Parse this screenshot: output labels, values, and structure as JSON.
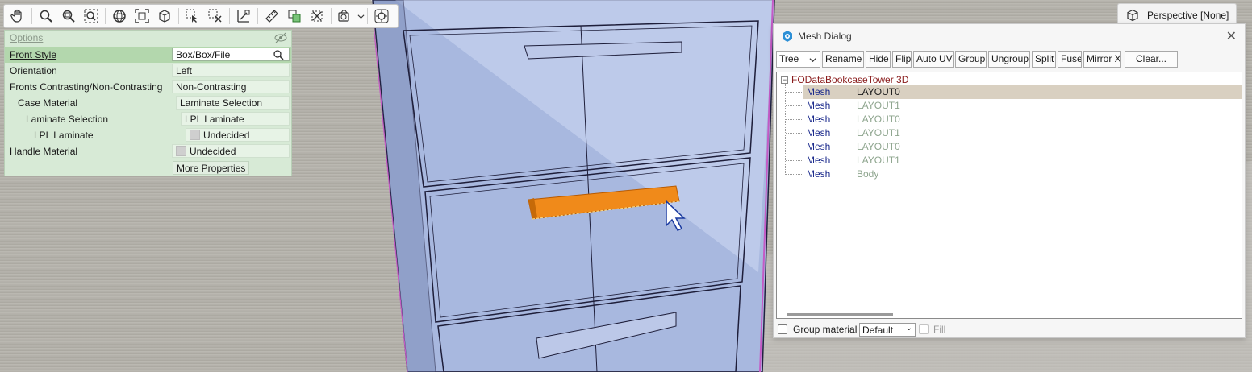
{
  "toolbar": {
    "icons": [
      "pan-hand-icon",
      "zoom-icon",
      "zoom-window-icon",
      "zoom-extents-icon",
      "orbit-icon",
      "frame-selection-icon",
      "view-cube-icon",
      "select-icon",
      "deselect-icon",
      "dimension-icon",
      "measure-icon",
      "add-object-icon",
      "delete-object-icon",
      "camera-icon",
      "target-icon"
    ]
  },
  "options": {
    "title": "Options",
    "rows": [
      {
        "label": "Front Style",
        "value": "Box/Box/File"
      },
      {
        "label": "Orientation",
        "value": "Left"
      },
      {
        "label": "Fronts Contrasting/Non-Contrasting",
        "value": "Non-Contrasting"
      },
      {
        "label": "Case Material",
        "value": "Laminate Selection"
      },
      {
        "label": "Laminate Selection",
        "value": "LPL Laminate"
      },
      {
        "label": "LPL Laminate",
        "value": "Undecided"
      },
      {
        "label": "Handle Material",
        "value": "Undecided"
      }
    ],
    "more_button": "More Properties"
  },
  "perspective": {
    "label": "Perspective [None]"
  },
  "mesh_dialog": {
    "title": "Mesh Dialog",
    "view_select": "Tree",
    "buttons": [
      "Rename",
      "Hide",
      "Flip",
      "Auto UV",
      "Group",
      "Ungroup",
      "Split",
      "Fuse",
      "Mirror X",
      "Clear..."
    ],
    "root": "FODataBookcaseTower 3D",
    "items": [
      {
        "type": "Mesh",
        "name": "LAYOUT0"
      },
      {
        "type": "Mesh",
        "name": "LAYOUT1"
      },
      {
        "type": "Mesh",
        "name": "LAYOUT0"
      },
      {
        "type": "Mesh",
        "name": "LAYOUT1"
      },
      {
        "type": "Mesh",
        "name": "LAYOUT0"
      },
      {
        "type": "Mesh",
        "name": "LAYOUT1"
      },
      {
        "type": "Mesh",
        "name": "Body"
      }
    ],
    "group_material_label": "Group material",
    "material_select": "Default",
    "fill_label": "Fill"
  },
  "colors": {
    "panel_bg": "#d7ead6",
    "selected_row": "#d9d0c1",
    "highlight_handle": "#f08a1a",
    "cabinet_glass": "#a9b9de",
    "floor": "#b9b6ae"
  }
}
